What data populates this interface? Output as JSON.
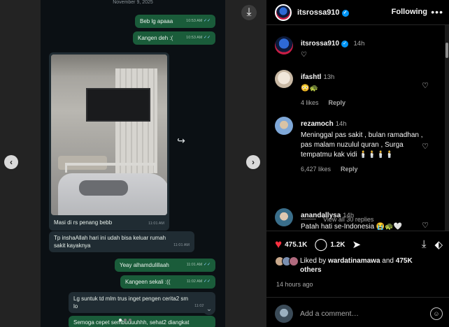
{
  "chat": {
    "date": "November 9, 2025",
    "messages": [
      {
        "text": "Beb lg apaaa",
        "time": "10:53 AM"
      },
      {
        "text": "Kangen deh :(",
        "time": "10:53 AM"
      }
    ],
    "photo_caption": "Masi di rs penang bebb",
    "photo_time": "11:01 AM",
    "incoming_1": {
      "text_1": "Tp inshaAllah hari ini udah bisa keluar rumah",
      "text_2": "sakit kayaknya",
      "time": "11:01 AM"
    },
    "out_2": {
      "text": "Yeay alhamdulillaah",
      "time": "11:01 AM"
    },
    "out_3": {
      "text": "Kangeen sekali :((",
      "time": "11:02 AM"
    },
    "incoming_2": {
      "text_1": "Lg suntuk td mlm trus inget pengen cerita2 sm",
      "text_2": "lo",
      "time": "11:02 AM"
    },
    "out_4": {
      "text": "Semoga cepet sembuuuuhhh, sehat2 diangkat"
    },
    "read_check": "✓✓"
  },
  "post": {
    "header": {
      "username": "itsrossa910",
      "follow_label": "Following",
      "more_label": "•••"
    },
    "caption": {
      "username": "itsrossa910",
      "time": "14h"
    },
    "comments": [
      {
        "user": "ifashtl",
        "time": "13h",
        "text": "😳🐢",
        "likes": "4 likes",
        "reply": "Reply"
      },
      {
        "user": "rezamoch",
        "time": "14h",
        "text": "Meninggal pas sakit , bulan ramadhan , pas malam nuzulul quran , Surga tempatmu kak vidi 🕯️🕯️🕯️🕯️",
        "likes": "6,427 likes",
        "reply": "Reply"
      },
      {
        "user": "anandallysa",
        "time": "14h",
        "text": "Patah hati se-Indonesia 😭🐢🤍"
      }
    ],
    "view_replies": "View all 30 replies",
    "likes_count": "475.1K",
    "comments_count": "1.2K",
    "liked_by_prefix": "Liked by",
    "liked_by_user": "wardatinamawa",
    "liked_by_and": "and",
    "liked_by_count": "475K",
    "liked_by_suffix": "others",
    "ago": "14 hours ago",
    "add_comment_placeholder": "Add a comment…"
  },
  "icons": {
    "download": "⤓",
    "prev": "‹",
    "next": "›",
    "forward": "↪",
    "scroll_down": "⌄",
    "heart_filled": "♥",
    "heart_outline": "♡",
    "comment": "◯",
    "share": "➤",
    "save": "⬖",
    "emoji": "☺"
  },
  "colors": {
    "accent": "#0095f6",
    "like_red": "#ff3040",
    "bubble_out": "#1a5c3a",
    "bubble_in": "#202c33"
  }
}
